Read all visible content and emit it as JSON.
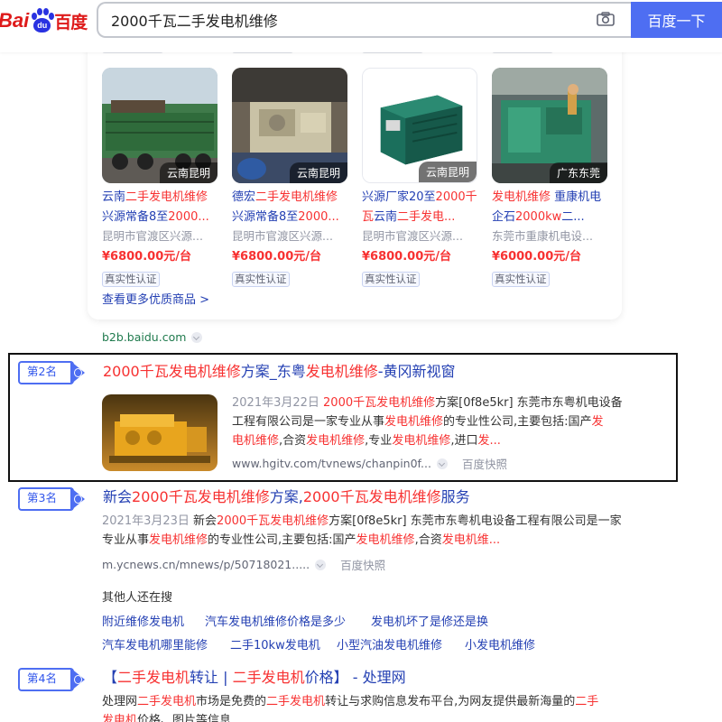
{
  "header": {
    "logo_text": "Bai",
    "logo_paw_text": "du",
    "logo_cn": "百度",
    "search_value": "2000千瓦二手发电机维修",
    "search_button": "百度一下"
  },
  "products": [
    {
      "location": "云南昆明",
      "title_parts": [
        [
          "云南",
          ""
        ],
        [
          "二手发电机维修",
          "hl"
        ],
        [
          "兴源常备8至",
          ""
        ],
        [
          "2000...",
          "hl"
        ]
      ],
      "seller": "昆明市官渡区兴源...",
      "price": "¥6800.00元/台",
      "badge": "真实性认证"
    },
    {
      "location": "云南昆明",
      "title_parts": [
        [
          "德宏",
          ""
        ],
        [
          "二手发电机维修",
          "hl"
        ],
        [
          "兴源常备8至",
          ""
        ],
        [
          "2000...",
          "hl"
        ]
      ],
      "seller": "昆明市官渡区兴源...",
      "price": "¥6800.00元/台",
      "badge": "真实性认证"
    },
    {
      "location": "云南昆明",
      "title_parts": [
        [
          "兴源厂家20至",
          ""
        ],
        [
          "2000千瓦",
          "hl"
        ],
        [
          "云南",
          ""
        ],
        [
          "二手发电...",
          "hl"
        ]
      ],
      "seller": "昆明市官渡区兴源...",
      "price": "¥6800.00元/台",
      "badge": "真实性认证"
    },
    {
      "location": "广东东莞",
      "title_parts": [
        [
          "发电机维修",
          "hl"
        ],
        [
          " 重康机电企石",
          ""
        ],
        [
          "2000kw",
          "hl"
        ],
        [
          "二...",
          ""
        ]
      ],
      "seller": "东莞市重康机电设...",
      "price": "¥6000.00元/台",
      "badge": "真实性认证"
    }
  ],
  "card": {
    "more_link": "查看更多优质商品 >",
    "source": "b2b.baidu.com"
  },
  "results": [
    {
      "rank": "第2名",
      "title_parts": [
        [
          "2000千瓦发电机维修",
          "hl"
        ],
        [
          "方案_东粤",
          ""
        ],
        [
          "发电机维修",
          "hl"
        ],
        [
          "-黄冈新视窗",
          ""
        ]
      ],
      "abstract_lines": [
        [
          [
            "2021年3月22日 ",
            "date"
          ],
          [
            "2000千瓦发电机维修",
            "hl"
          ],
          [
            "方案[0f8e5kr] 东莞市东粤机电设备",
            ""
          ]
        ],
        [
          [
            "工程有限公司是一家专业从事",
            ""
          ],
          [
            "发电机维修",
            "hl"
          ],
          [
            "的专业性公司,主要包括:国产",
            ""
          ],
          [
            "发",
            "hl"
          ]
        ],
        [
          [
            "电机维修",
            "hl"
          ],
          [
            ",合资",
            ""
          ],
          [
            "发电机维修",
            "hl"
          ],
          [
            ",专业",
            ""
          ],
          [
            "发电机维修",
            "hl"
          ],
          [
            ",进口",
            ""
          ],
          [
            "发...",
            "hl"
          ]
        ]
      ],
      "url": "www.hgitv.com/tvnews/chanpin0f...",
      "snapshot": "百度快照"
    },
    {
      "rank": "第3名",
      "title_parts": [
        [
          "新会",
          ""
        ],
        [
          "2000千瓦发电机维修",
          "hl"
        ],
        [
          "方案,",
          ""
        ],
        [
          "2000千瓦发电机维修",
          "hl"
        ],
        [
          "服务",
          ""
        ]
      ],
      "abstract_lines": [
        [
          [
            "2021年3月23日 ",
            "date"
          ],
          [
            "新会",
            ""
          ],
          [
            "2000千瓦发电机维修",
            "hl"
          ],
          [
            "方案[0f8e5kr] 东莞市东粤机电设备工程有限公司是一家",
            ""
          ]
        ],
        [
          [
            "专业从事",
            ""
          ],
          [
            "发电机维修",
            "hl"
          ],
          [
            "的专业性公司,主要包括:国产",
            ""
          ],
          [
            "发电机维修",
            "hl"
          ],
          [
            ",合资",
            ""
          ],
          [
            "发电机维...",
            "hl"
          ]
        ]
      ],
      "url": "m.ycnews.cn/mnews/p/50718021.....",
      "snapshot": "百度快照"
    },
    {
      "rank": "第4名",
      "title_parts": [
        [
          "【",
          ""
        ],
        [
          "二手发电机",
          "hl"
        ],
        [
          "转让 | ",
          ""
        ],
        [
          "二手发电机",
          "hl"
        ],
        [
          "价格】 - 处理网",
          ""
        ]
      ],
      "abstract_lines": [
        [
          [
            "处理网",
            ""
          ],
          [
            "二手发电机",
            "hl"
          ],
          [
            "市场是免费的",
            ""
          ],
          [
            "二手发电机",
            "hl"
          ],
          [
            "转让与求购信息发布平台,为网友提供最新海量的",
            ""
          ],
          [
            "二手",
            "hl"
          ]
        ],
        [
          [
            "发电机",
            "hl"
          ],
          [
            "价格、图片等信息",
            ""
          ]
        ]
      ]
    }
  ],
  "related": {
    "title": "其他人还在搜",
    "items": [
      "附近维修发电机",
      "汽车发电机维修价格是多少",
      "发电机坏了是修还是换",
      "汽车发电机哪里能修",
      "二手10kw发电机",
      "小型汽油发电机维修",
      "小发电机维修"
    ]
  }
}
